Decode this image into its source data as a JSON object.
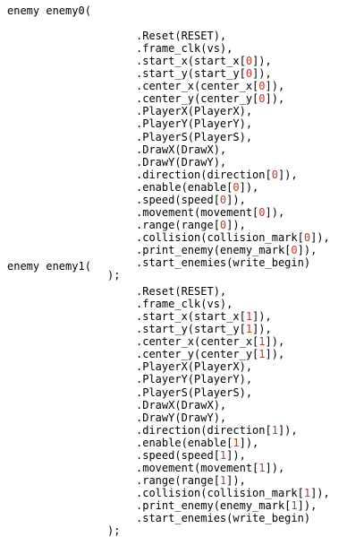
{
  "colors": {
    "text": "#000000",
    "number_literal": "#c0392b",
    "background": "#ffffff"
  },
  "blocks": [
    {
      "header": "enemy enemy0(",
      "lines": [
        [
          ".Reset(RESET),"
        ],
        [
          ".frame_clk(vs),"
        ],
        [
          ".start_x(start_x[",
          "0",
          "]),"
        ],
        [
          ".start_y(start_y[",
          "0",
          "]),"
        ],
        [
          ".center_x(center_x[",
          "0",
          "]),"
        ],
        [
          ".center_y(center_y[",
          "0",
          "]),"
        ],
        [
          ".PlayerX(PlayerX),"
        ],
        [
          ".PlayerY(PlayerY),"
        ],
        [
          ".PlayerS(PlayerS),"
        ],
        [
          ".DrawX(DrawX),"
        ],
        [
          ".DrawY(DrawY),"
        ],
        [
          ".direction(direction[",
          "0",
          "]),"
        ],
        [
          ".enable(enable[",
          "0",
          "]),"
        ],
        [
          ".speed(speed[",
          "0",
          "]),"
        ],
        [
          ".movement(movement[",
          "0",
          "]),"
        ],
        [
          ".range(range[",
          "0",
          "]),"
        ],
        [
          ".collision(collision_mark[",
          "0",
          "]),"
        ],
        [
          ".print_enemy(enemy_mark[",
          "0",
          "]),"
        ],
        [
          ".start_enemies(write_begin)"
        ]
      ],
      "footer": ");"
    },
    {
      "header": "enemy enemy1(",
      "lines": [
        [
          ".Reset(RESET),"
        ],
        [
          ".frame_clk(vs),"
        ],
        [
          ".start_x(start_x[",
          "1",
          "]),"
        ],
        [
          ".start_y(start_y[",
          "1",
          "]),"
        ],
        [
          ".center_x(center_x[",
          "1",
          "]),"
        ],
        [
          ".center_y(center_y[",
          "1",
          "]),"
        ],
        [
          ".PlayerX(PlayerX),"
        ],
        [
          ".PlayerY(PlayerY),"
        ],
        [
          ".PlayerS(PlayerS),"
        ],
        [
          ".DrawX(DrawX),"
        ],
        [
          ".DrawY(DrawY),"
        ],
        [
          ".direction(direction[",
          "1",
          "]),"
        ],
        [
          ".enable(enable[",
          "1",
          "]),"
        ],
        [
          ".speed(speed[",
          "1",
          "]),"
        ],
        [
          ".movement(movement[",
          "1",
          "]),"
        ],
        [
          ".range(range[",
          "1",
          "]),"
        ],
        [
          ".collision(collision_mark[",
          "1",
          "]),"
        ],
        [
          ".print_enemy(enemy_mark[",
          "1",
          "]),"
        ],
        [
          ".start_enemies(write_begin)"
        ]
      ],
      "footer": ");"
    }
  ]
}
